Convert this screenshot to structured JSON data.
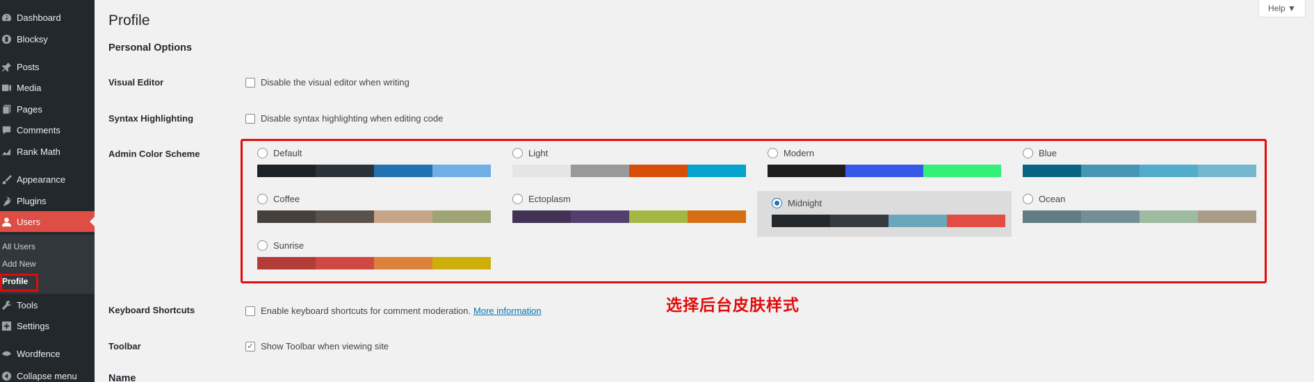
{
  "sidebar": {
    "items": [
      {
        "label": "Dashboard",
        "icon": "dashboard-icon",
        "active": false
      },
      {
        "label": "Blocksy",
        "icon": "blocksy-icon",
        "active": false
      },
      {
        "label": "Posts",
        "icon": "pin-icon",
        "active": false
      },
      {
        "label": "Media",
        "icon": "media-icon",
        "active": false
      },
      {
        "label": "Pages",
        "icon": "pages-icon",
        "active": false
      },
      {
        "label": "Comments",
        "icon": "comment-icon",
        "active": false
      },
      {
        "label": "Rank Math",
        "icon": "rank-math-icon",
        "active": false
      },
      {
        "label": "Appearance",
        "icon": "brush-icon",
        "active": false
      },
      {
        "label": "Plugins",
        "icon": "plugin-icon",
        "active": false
      },
      {
        "label": "Users",
        "icon": "users-icon",
        "active": true
      },
      {
        "label": "Tools",
        "icon": "wrench-icon",
        "active": false
      },
      {
        "label": "Settings",
        "icon": "settings-icon",
        "active": false
      },
      {
        "label": "Wordfence",
        "icon": "wordfence-icon",
        "active": false
      },
      {
        "label": "Collapse menu",
        "icon": "collapse-icon",
        "active": false
      }
    ],
    "submenu": [
      {
        "label": "All Users"
      },
      {
        "label": "Add New"
      },
      {
        "label": "Profile",
        "current": true
      }
    ]
  },
  "header": {
    "title": "Profile",
    "help_label": "Help ▼"
  },
  "personal_options": {
    "heading": "Personal Options",
    "visual_editor": {
      "label": "Visual Editor",
      "checkbox_text": "Disable the visual editor when writing",
      "checked": false
    },
    "syntax": {
      "label": "Syntax Highlighting",
      "checkbox_text": "Disable syntax highlighting when editing code",
      "checked": false
    },
    "color_scheme": {
      "label": "Admin Color Scheme",
      "selected": "Midnight",
      "schemes": [
        {
          "name": "Default",
          "colors": [
            "#1d2327",
            "#2c3338",
            "#2271b1",
            "#72aee6"
          ]
        },
        {
          "name": "Light",
          "colors": [
            "#e5e5e5",
            "#999999",
            "#d64e07",
            "#04a4cc"
          ]
        },
        {
          "name": "Modern",
          "colors": [
            "#1e1e1e",
            "#3858e9",
            "#33f078"
          ]
        },
        {
          "name": "Blue",
          "colors": [
            "#096484",
            "#4796b3",
            "#52accc",
            "#74b6ce"
          ]
        },
        {
          "name": "Coffee",
          "colors": [
            "#46403c",
            "#59524c",
            "#c7a589",
            "#9ea476"
          ]
        },
        {
          "name": "Ectoplasm",
          "colors": [
            "#413256",
            "#523f6d",
            "#a3b745",
            "#d46f15"
          ]
        },
        {
          "name": "Midnight",
          "colors": [
            "#25282b",
            "#363b3f",
            "#69a8bb",
            "#e14d43"
          ]
        },
        {
          "name": "Ocean",
          "colors": [
            "#627c83",
            "#738e96",
            "#9ebaa0",
            "#aa9d88"
          ]
        },
        {
          "name": "Sunrise",
          "colors": [
            "#b43c38",
            "#cf4944",
            "#dd823b",
            "#ccaf0b"
          ]
        }
      ]
    },
    "keyboard": {
      "label": "Keyboard Shortcuts",
      "checkbox_text": "Enable keyboard shortcuts for comment moderation.",
      "link_text": "More information",
      "checked": false
    },
    "toolbar": {
      "label": "Toolbar",
      "checkbox_text": "Show Toolbar when viewing site",
      "checked": true
    }
  },
  "annotation": "选择后台皮肤样式",
  "name_heading": "Name",
  "colors": {
    "accent_red": "#e00b0b",
    "active_menu": "#dd4e44",
    "sidebar": "#23282d",
    "link": "#0073aa"
  }
}
